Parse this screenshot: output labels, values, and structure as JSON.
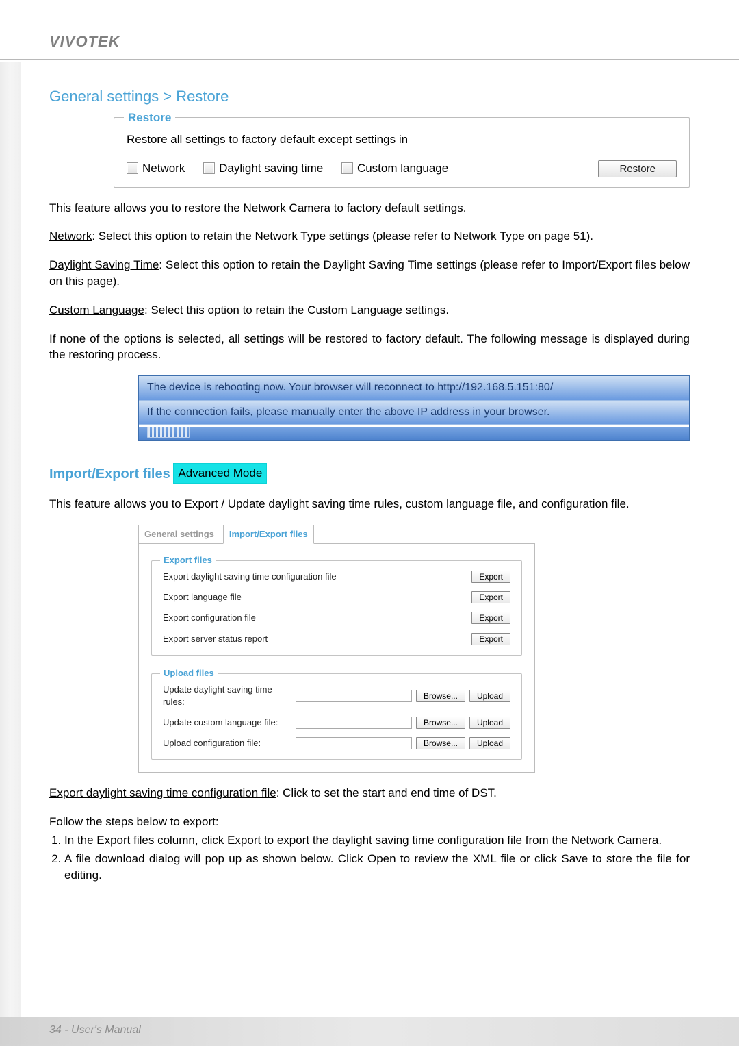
{
  "brand": "VIVOTEK",
  "section_heading": "General settings > Restore",
  "restore_panel": {
    "legend": "Restore",
    "instructions": "Restore all settings to factory default except settings in",
    "checkboxes": {
      "network": "Network",
      "dst": "Daylight saving time",
      "lang": "Custom language"
    },
    "button": "Restore"
  },
  "p_intro": "This feature allows you to restore the Network Camera to factory default settings.",
  "p_network_key": "Network",
  "p_network_rest": ": Select this option to retain the Network Type settings (please refer to Network Type on page 51).",
  "p_dst_key": "Daylight Saving Time",
  "p_dst_rest": ": Select this option to retain the Daylight Saving Time settings (please refer to Import/Export files below on this page).",
  "p_lang_key": "Custom Language",
  "p_lang_rest": ": Select this option to retain the Custom Language settings.",
  "p_none": "If none of the options is selected, all settings will be restored to factory default.  The following message is displayed during the restoring process.",
  "reboot": {
    "l1": "The device is rebooting now. Your browser will reconnect to http://192.168.5.151:80/",
    "l2": "If the connection fails, please manually enter the above IP address in your browser."
  },
  "ie": {
    "title": "Import/Export files",
    "badge": "Advanced Mode",
    "desc": "This feature allows you to Export / Update daylight saving time rules, custom language file, and configuration file.",
    "tabs": {
      "general": "General settings",
      "ie": "Import/Export files"
    },
    "export": {
      "legend": "Export files",
      "dst": "Export daylight saving time configuration file",
      "lang": "Export language file",
      "config": "Export configuration file",
      "status": "Export server status report",
      "btn": "Export"
    },
    "upload": {
      "legend": "Upload files",
      "dst": "Update daylight saving time rules:",
      "lang": "Update custom language file:",
      "config": "Upload configuration file:",
      "browse": "Browse...",
      "upload": "Upload"
    }
  },
  "after": {
    "title_key": "Export daylight saving time configuration file",
    "title_rest": ": Click to set the start and end time of DST.",
    "follow": "Follow the steps below to export:",
    "step1": "In the Export files column, click Export  to export the daylight saving time configuration file from the Network Camera.",
    "step2": "A file download dialog will pop up as shown below. Click Open to review the XML file or click Save to store the file for editing."
  },
  "footer": "34 - User's Manual"
}
